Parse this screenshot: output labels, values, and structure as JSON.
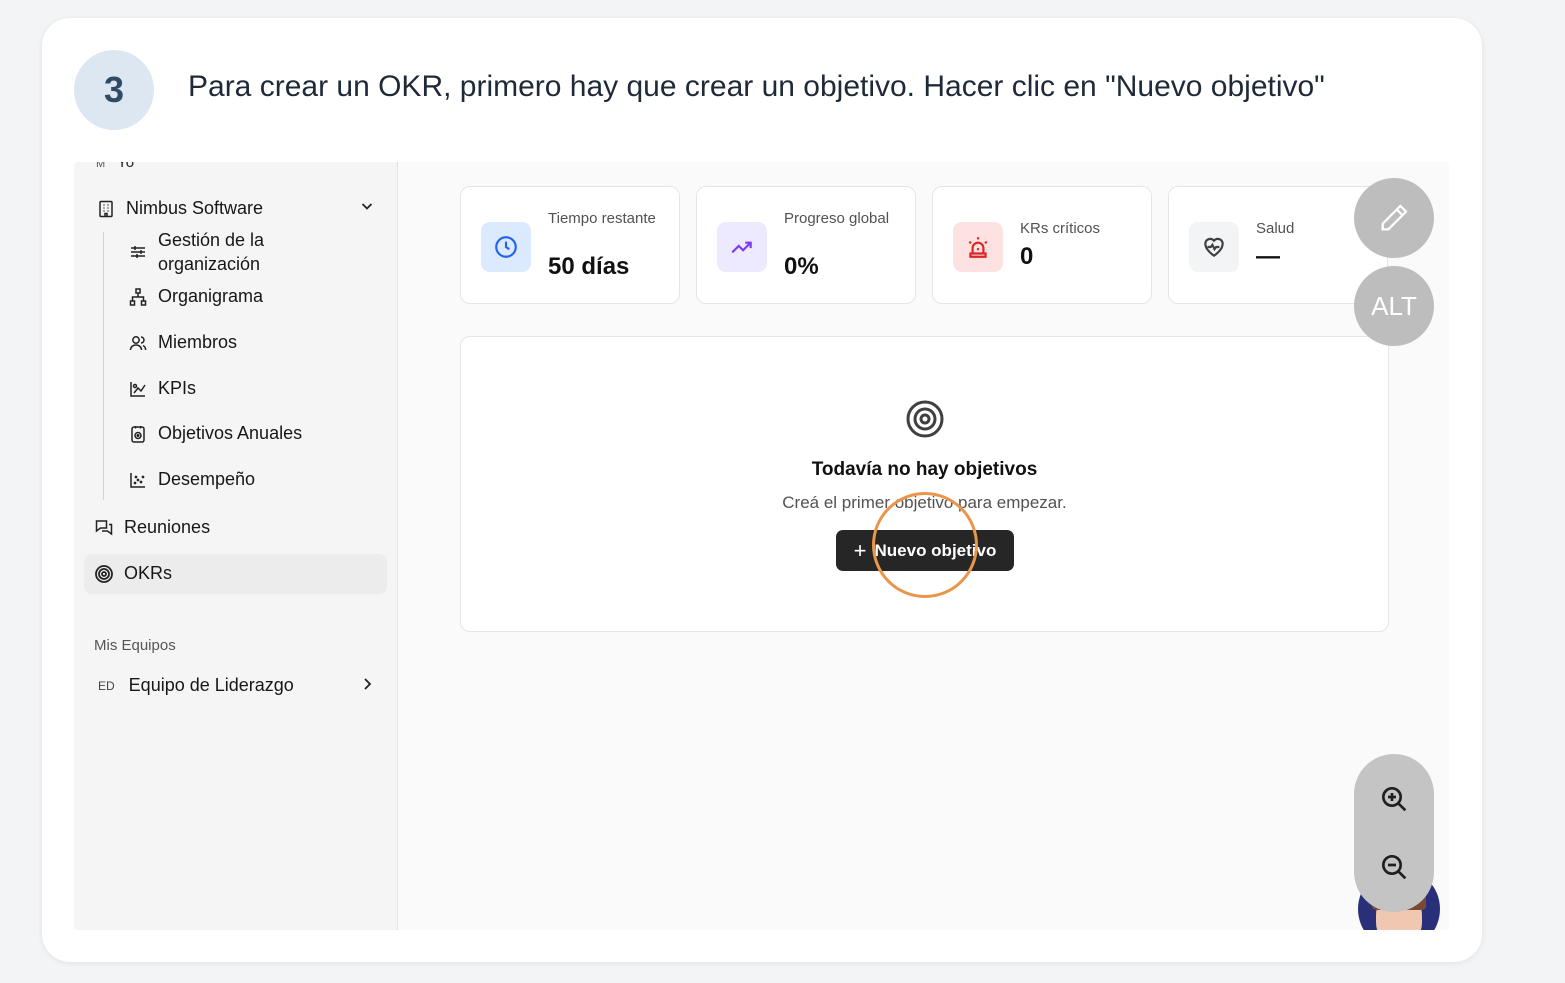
{
  "step": {
    "number": "3",
    "instruction": "Para crear un OKR, primero hay que crear un objetivo. Hacer clic en \"Nuevo objetivo\""
  },
  "sidebar": {
    "cut_top": {
      "abbr": "M",
      "label": "Yo"
    },
    "org": {
      "name": "Nimbus Software",
      "chevron": "chevron-down-icon"
    },
    "org_items": [
      {
        "label": "Gestión de la organización",
        "icon": "sliders-icon"
      },
      {
        "label": "Organigrama",
        "icon": "org-chart-icon"
      },
      {
        "label": "Miembros",
        "icon": "users-icon"
      },
      {
        "label": "KPIs",
        "icon": "kpi-chart-icon"
      },
      {
        "label": "Objetivos Anuales",
        "icon": "annual-goals-icon"
      },
      {
        "label": "Desempeño",
        "icon": "scatter-chart-icon"
      }
    ],
    "top_items": [
      {
        "label": "Reuniones",
        "icon": "chat-icon"
      },
      {
        "label": "OKRs",
        "icon": "target-icon",
        "active": true
      }
    ],
    "section_label": "Mis Equipos",
    "team": {
      "abbr": "ED",
      "label": "Equipo de Liderazgo"
    }
  },
  "stats": [
    {
      "label": "Tiempo restante",
      "value": "50 días",
      "icon": "clock-icon",
      "color": "#dbeafe",
      "icon_color": "#2563eb"
    },
    {
      "label": "Progreso global",
      "value": "0%",
      "icon": "trending-up-icon",
      "color": "#ede9fe",
      "icon_color": "#7c3aed"
    },
    {
      "label": "KRs críticos",
      "value": "0",
      "icon": "siren-icon",
      "color": "#fee2e2",
      "icon_color": "#dc2626"
    },
    {
      "label": "Salud",
      "value": "—",
      "icon": "heart-pulse-icon",
      "color": "#f3f4f6",
      "icon_color": "#404040"
    }
  ],
  "empty_state": {
    "icon": "target-icon",
    "title": "Todavía no hay objetivos",
    "subtitle": "Creá el primer objetivo para empezar.",
    "button_label": "Nuevo objetivo"
  },
  "overlay": {
    "edit_icon": "pencil-icon",
    "alt_label": "ALT",
    "zoom_in_icon": "zoom-in-icon",
    "zoom_out_icon": "zoom-out-icon",
    "highlight_color": "#e8964a"
  }
}
